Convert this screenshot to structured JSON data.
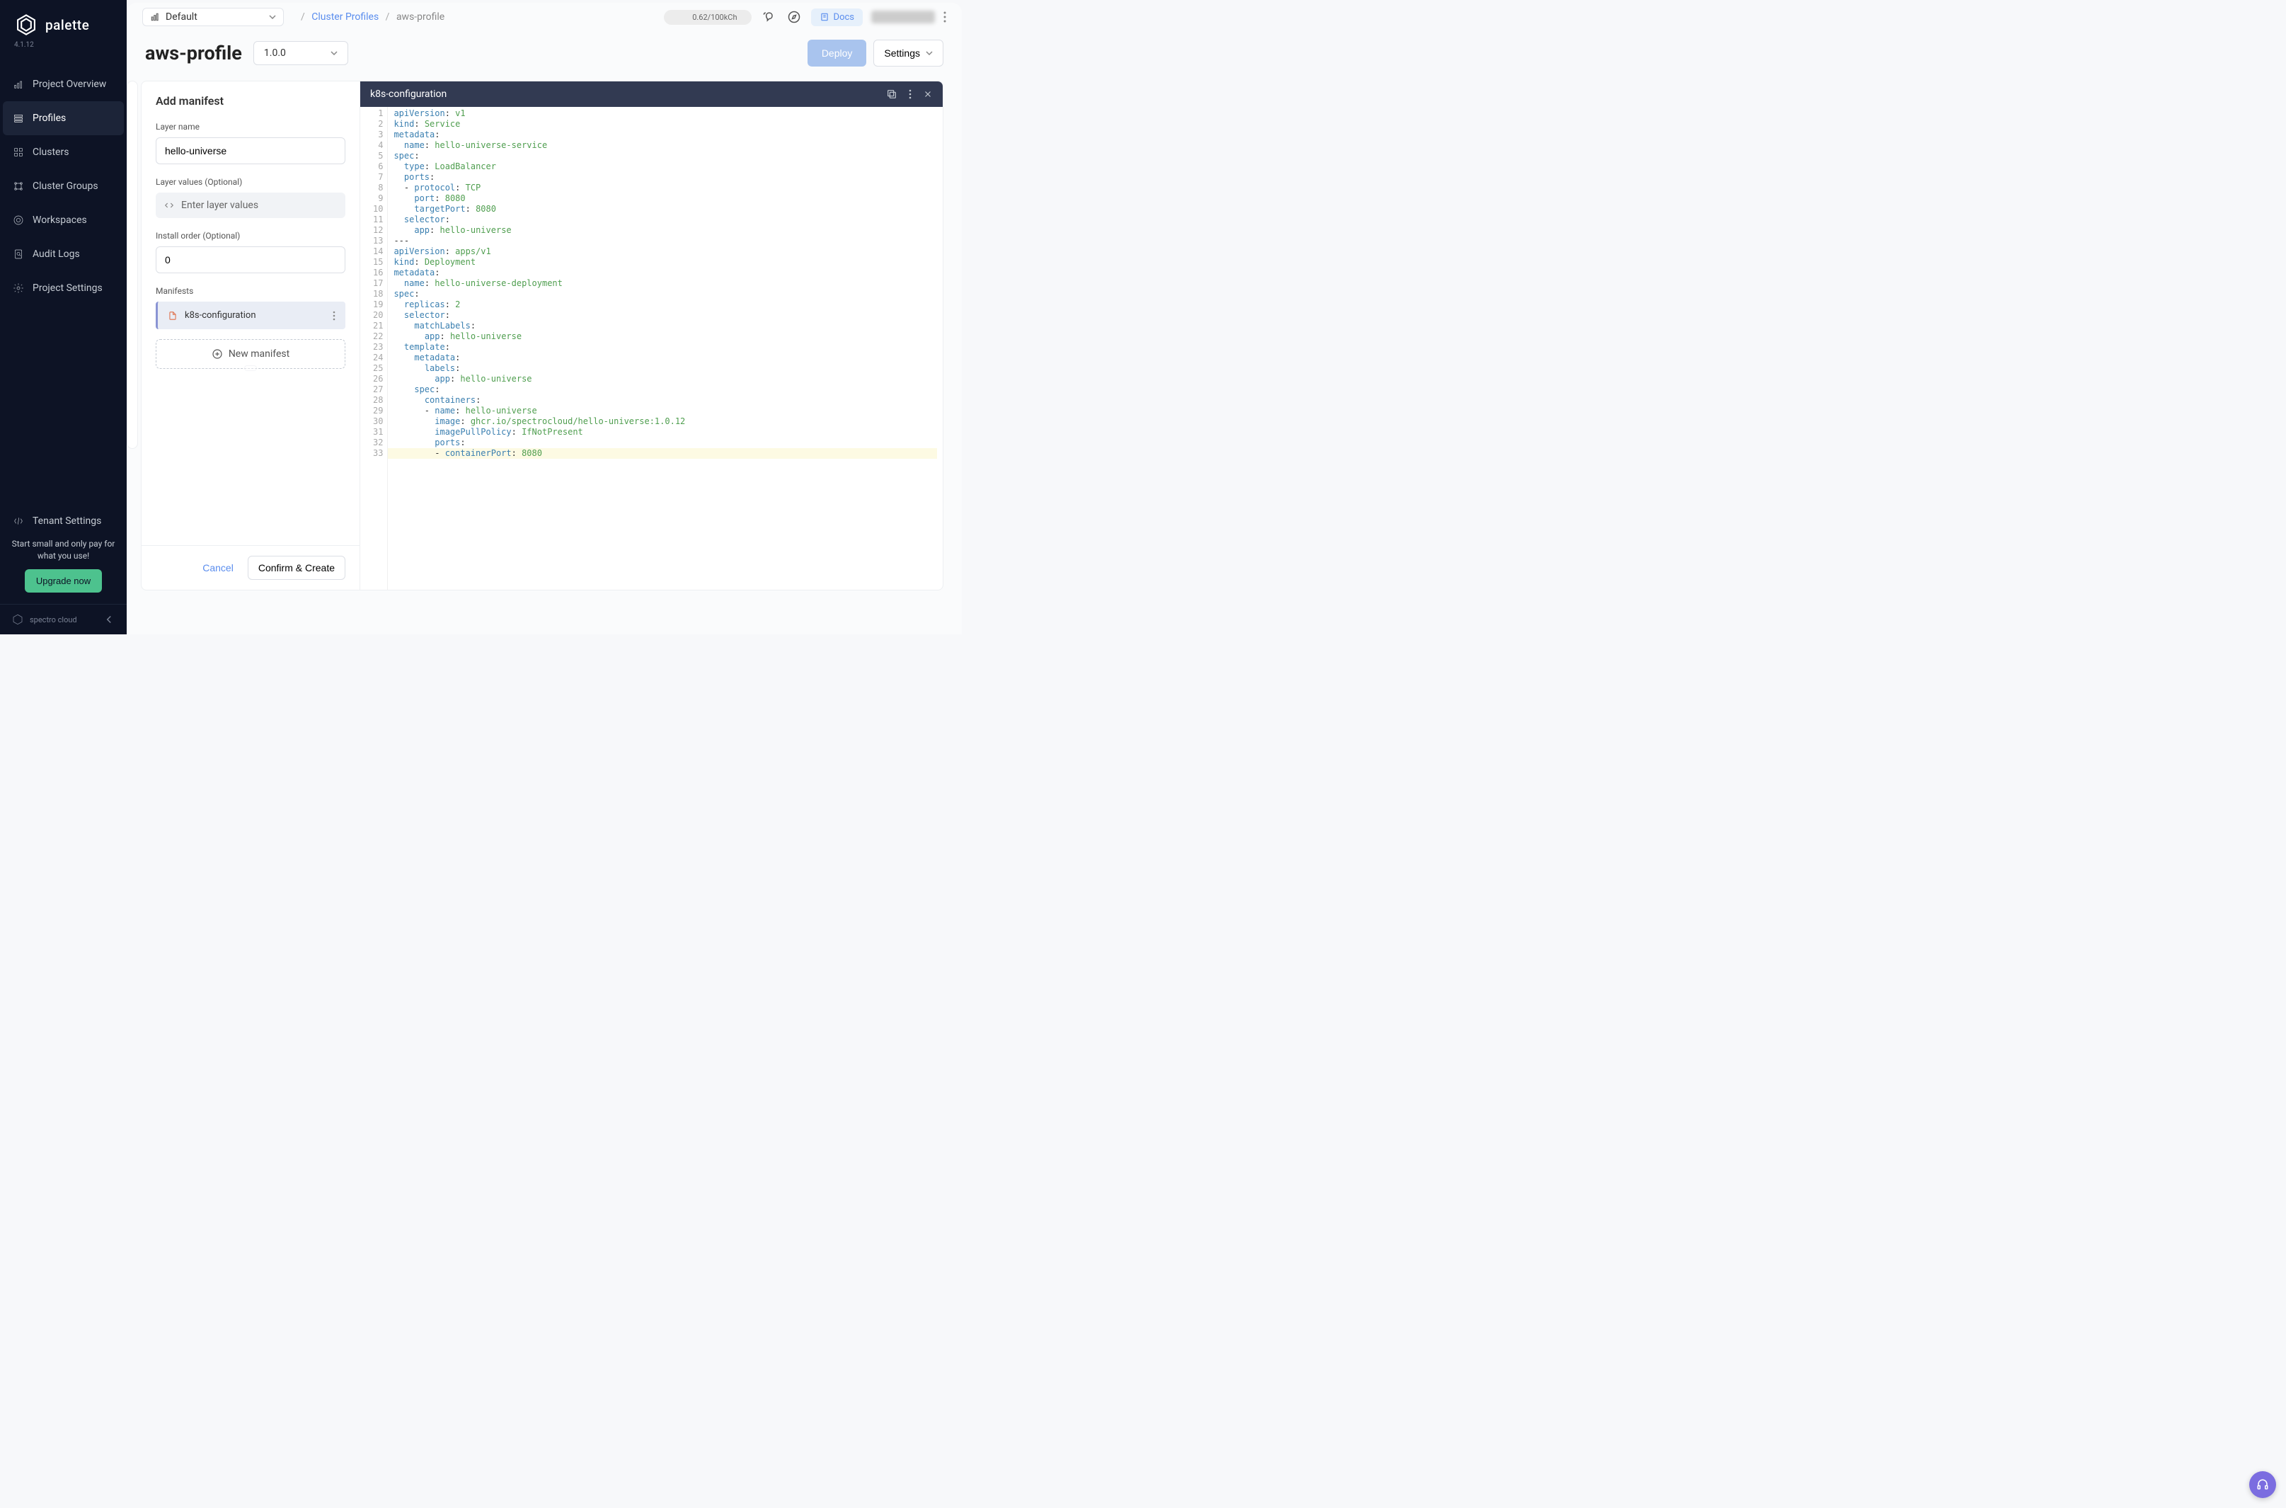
{
  "sidebar": {
    "product": "palette",
    "version": "4.1.12",
    "items": [
      {
        "label": "Project Overview"
      },
      {
        "label": "Profiles"
      },
      {
        "label": "Clusters"
      },
      {
        "label": "Cluster Groups"
      },
      {
        "label": "Workspaces"
      },
      {
        "label": "Audit Logs"
      },
      {
        "label": "Project Settings"
      }
    ],
    "tenant": "Tenant Settings",
    "upgrade_text": "Start small and only pay for what you use!",
    "upgrade_btn": "Upgrade now",
    "brand": "spectro cloud"
  },
  "topbar": {
    "project": "Default",
    "breadcrumb_link": "Cluster Profiles",
    "breadcrumb_current": "aws-profile",
    "usage": "0.62/100kCh",
    "docs": "Docs"
  },
  "subheader": {
    "title": "aws-profile",
    "version": "1.0.0",
    "deploy": "Deploy",
    "settings": "Settings"
  },
  "form": {
    "title": "Add manifest",
    "layer_name_label": "Layer name",
    "layer_name_value": "hello-universe",
    "layer_values_label": "Layer values (Optional)",
    "layer_values_placeholder": "Enter layer values",
    "install_order_label": "Install order (Optional)",
    "install_order_value": "0",
    "manifests_label": "Manifests",
    "manifest_item": "k8s-configuration",
    "new_manifest": "New manifest",
    "cancel": "Cancel",
    "confirm": "Confirm & Create"
  },
  "editor": {
    "tab": "k8s-configuration",
    "code": [
      [
        [
          "k",
          "apiVersion"
        ],
        [
          "p",
          ": "
        ],
        [
          "v",
          "v1"
        ]
      ],
      [
        [
          "k",
          "kind"
        ],
        [
          "p",
          ": "
        ],
        [
          "v",
          "Service"
        ]
      ],
      [
        [
          "k",
          "metadata"
        ],
        [
          "p",
          ":"
        ]
      ],
      [
        [
          "p",
          "  "
        ],
        [
          "k",
          "name"
        ],
        [
          "p",
          ": "
        ],
        [
          "v",
          "hello-universe-service"
        ]
      ],
      [
        [
          "k",
          "spec"
        ],
        [
          "p",
          ":"
        ]
      ],
      [
        [
          "p",
          "  "
        ],
        [
          "k",
          "type"
        ],
        [
          "p",
          ": "
        ],
        [
          "v",
          "LoadBalancer"
        ]
      ],
      [
        [
          "p",
          "  "
        ],
        [
          "k",
          "ports"
        ],
        [
          "p",
          ":"
        ]
      ],
      [
        [
          "p",
          "  - "
        ],
        [
          "k",
          "protocol"
        ],
        [
          "p",
          ": "
        ],
        [
          "v",
          "TCP"
        ]
      ],
      [
        [
          "p",
          "    "
        ],
        [
          "k",
          "port"
        ],
        [
          "p",
          ": "
        ],
        [
          "v",
          "8080"
        ]
      ],
      [
        [
          "p",
          "    "
        ],
        [
          "k",
          "targetPort"
        ],
        [
          "p",
          ": "
        ],
        [
          "v",
          "8080"
        ]
      ],
      [
        [
          "p",
          "  "
        ],
        [
          "k",
          "selector"
        ],
        [
          "p",
          ":"
        ]
      ],
      [
        [
          "p",
          "    "
        ],
        [
          "k",
          "app"
        ],
        [
          "p",
          ": "
        ],
        [
          "v",
          "hello-universe"
        ]
      ],
      [
        [
          "p",
          "---"
        ]
      ],
      [
        [
          "k",
          "apiVersion"
        ],
        [
          "p",
          ": "
        ],
        [
          "v",
          "apps/v1"
        ]
      ],
      [
        [
          "k",
          "kind"
        ],
        [
          "p",
          ": "
        ],
        [
          "v",
          "Deployment"
        ]
      ],
      [
        [
          "k",
          "metadata"
        ],
        [
          "p",
          ":"
        ]
      ],
      [
        [
          "p",
          "  "
        ],
        [
          "k",
          "name"
        ],
        [
          "p",
          ": "
        ],
        [
          "v",
          "hello-universe-deployment"
        ]
      ],
      [
        [
          "k",
          "spec"
        ],
        [
          "p",
          ":"
        ]
      ],
      [
        [
          "p",
          "  "
        ],
        [
          "k",
          "replicas"
        ],
        [
          "p",
          ": "
        ],
        [
          "v",
          "2"
        ]
      ],
      [
        [
          "p",
          "  "
        ],
        [
          "k",
          "selector"
        ],
        [
          "p",
          ":"
        ]
      ],
      [
        [
          "p",
          "    "
        ],
        [
          "k",
          "matchLabels"
        ],
        [
          "p",
          ":"
        ]
      ],
      [
        [
          "p",
          "      "
        ],
        [
          "k",
          "app"
        ],
        [
          "p",
          ": "
        ],
        [
          "v",
          "hello-universe"
        ]
      ],
      [
        [
          "p",
          "  "
        ],
        [
          "k",
          "template"
        ],
        [
          "p",
          ":"
        ]
      ],
      [
        [
          "p",
          "    "
        ],
        [
          "k",
          "metadata"
        ],
        [
          "p",
          ":"
        ]
      ],
      [
        [
          "p",
          "      "
        ],
        [
          "k",
          "labels"
        ],
        [
          "p",
          ":"
        ]
      ],
      [
        [
          "p",
          "        "
        ],
        [
          "k",
          "app"
        ],
        [
          "p",
          ": "
        ],
        [
          "v",
          "hello-universe"
        ]
      ],
      [
        [
          "p",
          "    "
        ],
        [
          "k",
          "spec"
        ],
        [
          "p",
          ":"
        ]
      ],
      [
        [
          "p",
          "      "
        ],
        [
          "k",
          "containers"
        ],
        [
          "p",
          ":"
        ]
      ],
      [
        [
          "p",
          "      - "
        ],
        [
          "k",
          "name"
        ],
        [
          "p",
          ": "
        ],
        [
          "v",
          "hello-universe"
        ]
      ],
      [
        [
          "p",
          "        "
        ],
        [
          "k",
          "image"
        ],
        [
          "p",
          ": "
        ],
        [
          "v",
          "ghcr.io/spectrocloud/hello-universe:1.0.12"
        ]
      ],
      [
        [
          "p",
          "        "
        ],
        [
          "k",
          "imagePullPolicy"
        ],
        [
          "p",
          ": "
        ],
        [
          "v",
          "IfNotPresent"
        ]
      ],
      [
        [
          "p",
          "        "
        ],
        [
          "k",
          "ports"
        ],
        [
          "p",
          ":"
        ]
      ],
      [
        [
          "p",
          "        - "
        ],
        [
          "k",
          "containerPort"
        ],
        [
          "p",
          ": "
        ],
        [
          "v",
          "8080"
        ]
      ]
    ]
  }
}
